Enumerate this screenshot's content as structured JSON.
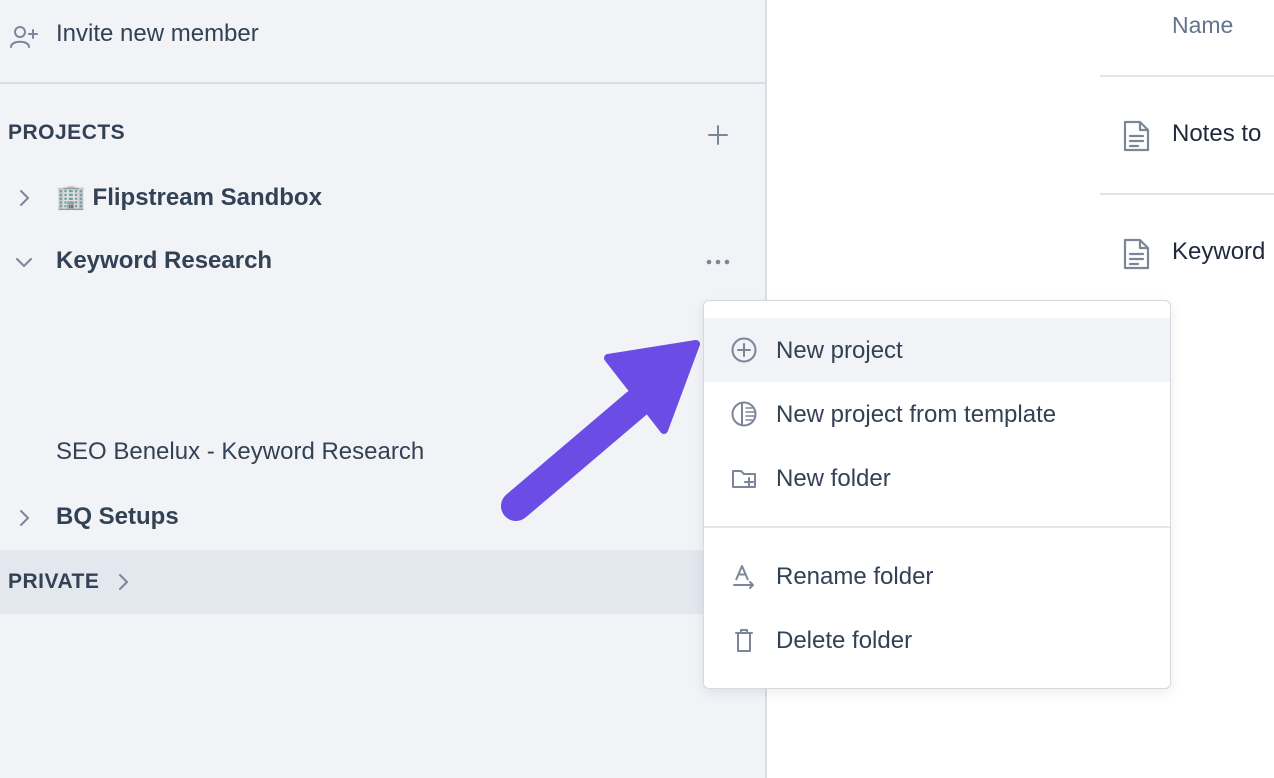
{
  "sidebar": {
    "invite_label": "Invite new member",
    "projects_header": "PROJECTS",
    "items": [
      {
        "label": "🏢 Flipstream Sandbox",
        "expanded": false
      },
      {
        "label": "Keyword Research",
        "expanded": true
      },
      {
        "label": "BQ Setups",
        "expanded": false
      }
    ],
    "sub_items": [
      "SEO Benelux - Keyword Research"
    ],
    "private_label": "PRIVATE"
  },
  "main": {
    "column_header": "Name",
    "rows": [
      {
        "label": "Notes to"
      },
      {
        "label": "Keyword"
      }
    ]
  },
  "context_menu": {
    "items": [
      {
        "label": "New project",
        "icon": "plus-circle-icon",
        "highlighted": true
      },
      {
        "label": "New project from template",
        "icon": "template-icon"
      },
      {
        "label": "New folder",
        "icon": "folder-plus-icon"
      }
    ],
    "secondary_items": [
      {
        "label": "Rename folder",
        "icon": "rename-icon"
      },
      {
        "label": "Delete folder",
        "icon": "trash-icon"
      }
    ]
  },
  "colors": {
    "sidebar_bg": "#f1f3f7",
    "private_row_bg": "#e3e7ee",
    "arrow": "#6b4de6",
    "text": "#334155",
    "icon": "#7b8799"
  }
}
